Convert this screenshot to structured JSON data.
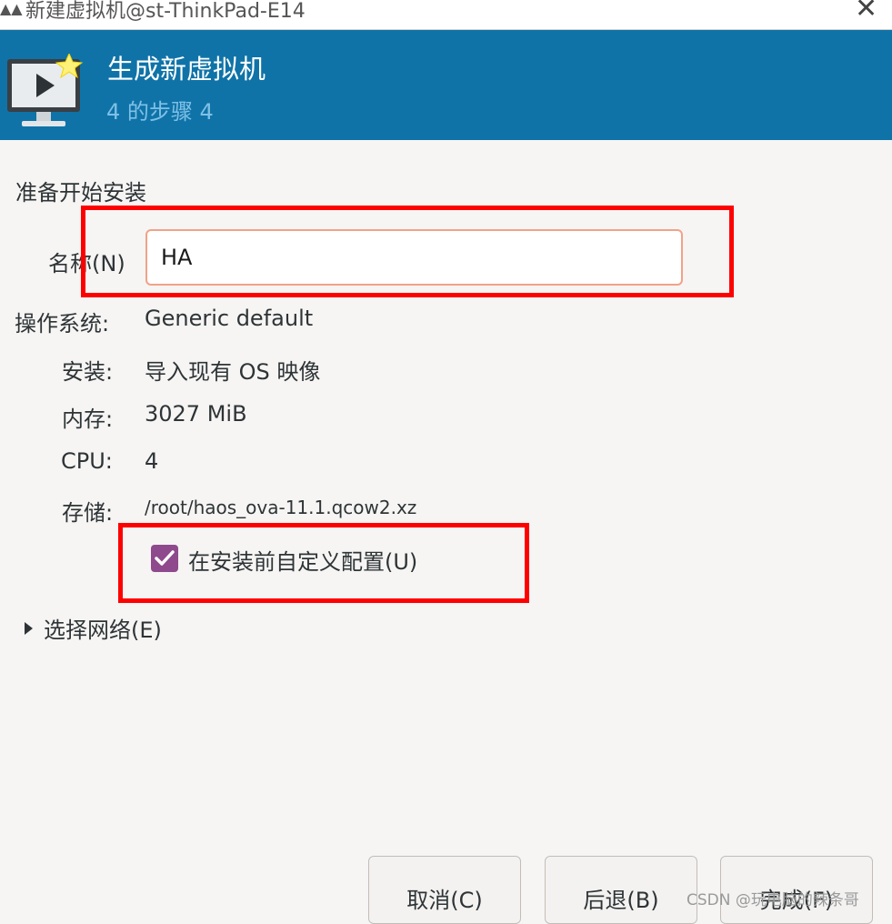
{
  "window": {
    "title": "新建虚拟机@st-ThinkPad-E14",
    "app_glyph": "▲▲"
  },
  "banner": {
    "heading": "生成新虚拟机",
    "step": "4 的步骤 4",
    "icon": "new-vm-monitor-icon"
  },
  "form": {
    "section_title": "准备开始安装",
    "name_label": "名称(N)",
    "name_value": "HA",
    "os_label": "操作系统:",
    "os_value": "Generic default",
    "install_label": "安装:",
    "install_value": "导入现有 OS 映像",
    "memory_label": "内存:",
    "memory_value": "3027 MiB",
    "cpu_label": "CPU:",
    "cpu_value": "4",
    "storage_label": "存储:",
    "storage_value": "/root/haos_ova-11.1.qcow2.xz",
    "customize_label": "在安装前自定义配置(U)",
    "customize_checked": true,
    "network_label": "选择网络(E)"
  },
  "buttons": {
    "cancel": "取消(C)",
    "back": "后退(B)",
    "finish": "完成(F)"
  },
  "watermark": "CSDN @玩电脑的辣条哥",
  "colors": {
    "banner": "#0f73a8",
    "checkbox": "#8e4a8c",
    "highlight": "#ff0000",
    "input_focus": "#f2a287"
  }
}
